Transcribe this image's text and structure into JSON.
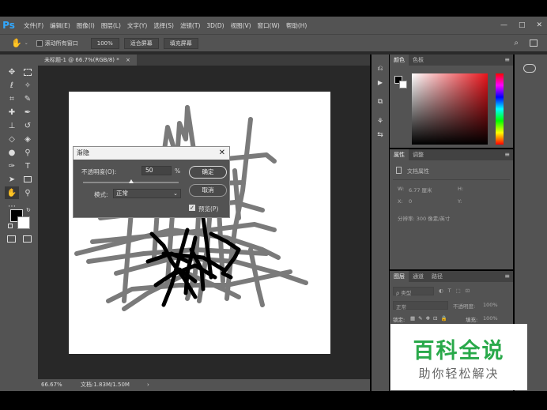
{
  "app": {
    "logo": "Ps"
  },
  "menu": [
    "文件(F)",
    "编辑(E)",
    "图像(I)",
    "图层(L)",
    "文字(Y)",
    "选择(S)",
    "滤镜(T)",
    "3D(D)",
    "视图(V)",
    "窗口(W)",
    "帮助(H)"
  ],
  "window_controls": [
    "—",
    "□",
    "✕"
  ],
  "options_bar": {
    "scroll_all": "滚动所有窗口",
    "zoom_100": "100%",
    "fit_screen": "适合屏幕",
    "fill_screen": "填充屏幕"
  },
  "document": {
    "tab_label": "未标题-1 @ 66.7%(RGB/8) *",
    "tab_close": "×"
  },
  "status": {
    "zoom": "66.67%",
    "doc_info": "文档:1.83M/1.50M",
    "arrow": "›"
  },
  "fade_dialog": {
    "title": "渐隐",
    "close": "✕",
    "opacity_label": "不透明度(O):",
    "opacity_value": "50",
    "opacity_unit": "%",
    "mode_label": "模式:",
    "mode_value": "正常",
    "ok": "确定",
    "cancel": "取消",
    "preview_label": "预览(P)",
    "preview_checked": true,
    "opacity_fraction": 0.5
  },
  "color_panel": {
    "tabs": [
      "颜色",
      "色板"
    ],
    "menu": "≡"
  },
  "properties_panel": {
    "tabs": [
      "属性",
      "调整"
    ],
    "doc_props": "文档属性",
    "w_label": "W:",
    "w_value": "6.77 厘米",
    "h_label": "H:",
    "x_label": "X:",
    "x_value": "0",
    "y_label": "Y:",
    "resolution": "分辨率: 300 像素/英寸"
  },
  "layers_panel": {
    "tabs": [
      "图层",
      "通道",
      "路径"
    ],
    "filter": "ρ 类型",
    "blend": "正常",
    "opacity_label": "不透明度:",
    "opacity": "100%",
    "lock_label": "锁定:",
    "fill_label": "填充:",
    "fill": "100%"
  },
  "watermark": {
    "title": "百科全说",
    "subtitle": "助你轻松解决"
  },
  "colors": {
    "ps_bg": "#535353",
    "accent_blue": "#31a8ff",
    "watermark_green": "#29a94a"
  }
}
